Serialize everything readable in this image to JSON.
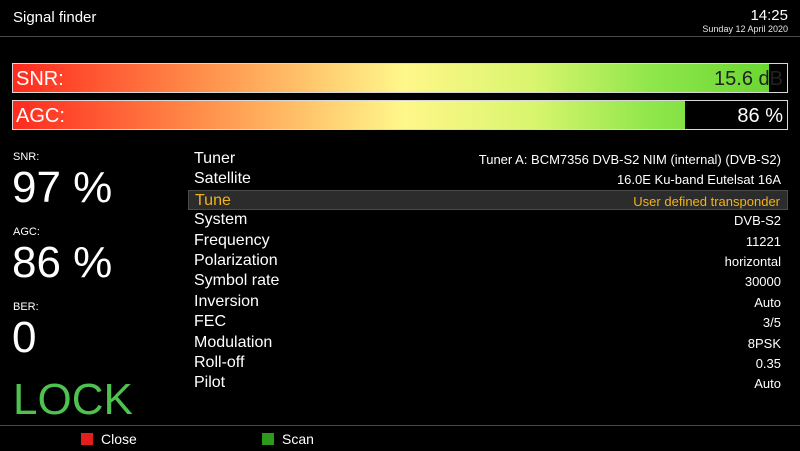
{
  "header": {
    "title": "Signal finder",
    "time": "14:25",
    "date": "Sunday 12 April 2020"
  },
  "meters": {
    "snr": {
      "label": "SNR:",
      "value": "15.6 dB",
      "fill_fraction": 0.977
    },
    "agc": {
      "label": "AGC:",
      "value": "86 %",
      "fill_fraction": 0.868
    }
  },
  "stats": {
    "snr_label": "SNR:",
    "snr_value": "97 %",
    "agc_label": "AGC:",
    "agc_value": "86 %",
    "ber_label": "BER:",
    "ber_value": "0",
    "lock": "LOCK"
  },
  "info_rows": [
    {
      "key": "Tuner",
      "value": "Tuner A: BCM7356 DVB-S2 NIM (internal) (DVB-S2)"
    },
    {
      "key": "Satellite",
      "value": "16.0E Ku-band Eutelsat 16A"
    },
    {
      "key": "Tune",
      "value": "User defined transponder",
      "selected": true
    },
    {
      "key": "System",
      "value": "DVB-S2"
    },
    {
      "key": "Frequency",
      "value": "11221"
    },
    {
      "key": "Polarization",
      "value": "horizontal"
    },
    {
      "key": "Symbol rate",
      "value": "30000"
    },
    {
      "key": "Inversion",
      "value": "Auto"
    },
    {
      "key": "FEC",
      "value": "3/5"
    },
    {
      "key": "Modulation",
      "value": "8PSK"
    },
    {
      "key": "Roll-off",
      "value": "0.35"
    },
    {
      "key": "Pilot",
      "value": "Auto"
    }
  ],
  "footer": {
    "red_label": "Close",
    "red_color": "#e41d1d",
    "green_label": "Scan",
    "green_color": "#2e9a1c"
  },
  "colors": {
    "lock": "#4ec24e",
    "selected_text": "#f2b21c"
  }
}
